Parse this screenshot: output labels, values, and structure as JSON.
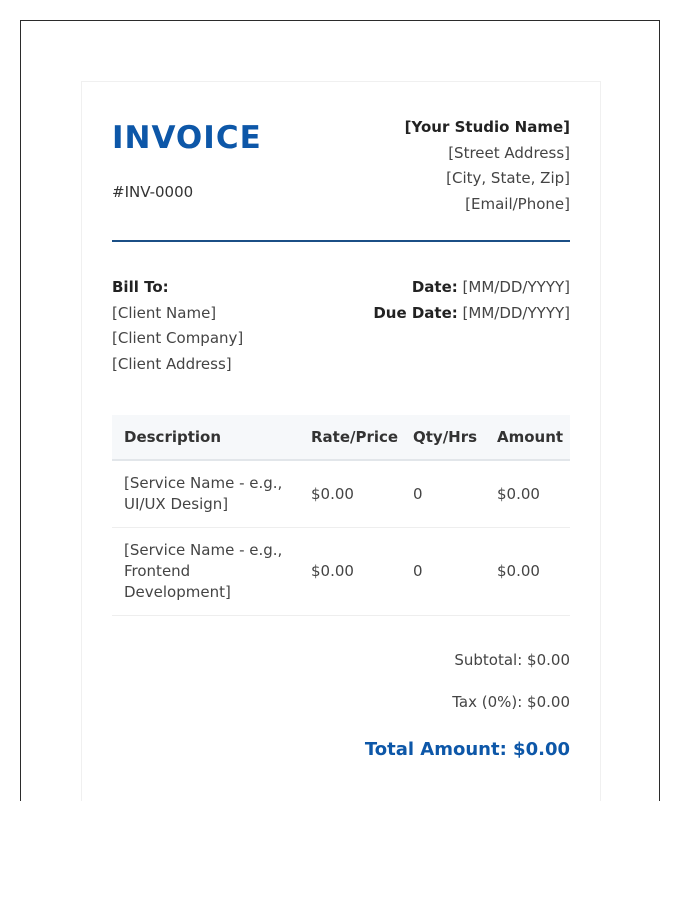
{
  "invoice": {
    "title": "INVOICE",
    "number": "#INV-0000"
  },
  "studio": {
    "name": "[Your Studio Name]",
    "street": "[Street Address]",
    "city": "[City, State, Zip]",
    "contact": "[Email/Phone]"
  },
  "bill_to": {
    "label": "Bill To:",
    "client_name": "[Client Name]",
    "client_company": "[Client Company]",
    "client_address": "[Client Address]"
  },
  "dates": {
    "date_label": "Date:",
    "date_value": "[MM/DD/YYYY]",
    "due_label": "Due Date:",
    "due_value": "[MM/DD/YYYY]"
  },
  "table": {
    "headers": [
      "Description",
      "Rate/Price",
      "Qty/Hrs",
      "Amount"
    ],
    "rows": [
      {
        "description": "[Service Name - e.g., UI/UX Design]",
        "rate": "$0.00",
        "qty": "0",
        "amount": "$0.00"
      },
      {
        "description": "[Service Name - e.g., Frontend Development]",
        "rate": "$0.00",
        "qty": "0",
        "amount": "$0.00"
      }
    ]
  },
  "totals": {
    "subtotal": "Subtotal: $0.00",
    "tax": "Tax (0%): $0.00",
    "total": "Total Amount: $0.00"
  },
  "colors": {
    "accent": "#0d57a8",
    "rule": "#1b4f86",
    "header_bg": "#f6f8fa"
  }
}
